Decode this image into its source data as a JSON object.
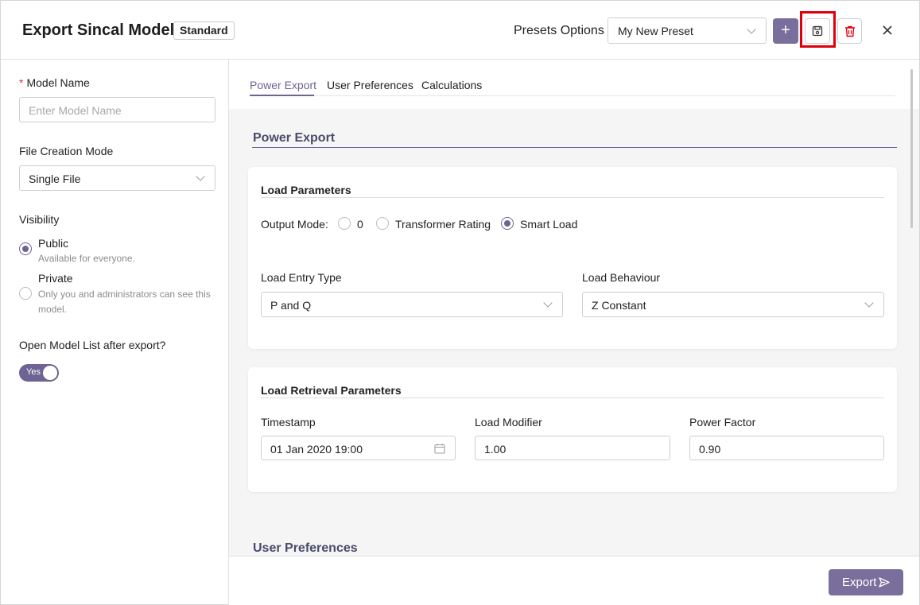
{
  "header": {
    "title": "Export Sincal Model",
    "badge": "Standard",
    "presets_label": "Presets Options",
    "preset_value": "My New Preset",
    "add_label": "+"
  },
  "left": {
    "model_name_label": "Model Name",
    "model_name_required": "*",
    "model_name_placeholder": "Enter Model Name",
    "file_mode_label": "File Creation Mode",
    "file_mode_value": "Single File",
    "visibility_label": "Visibility",
    "visibility_options": [
      {
        "label": "Public",
        "desc": "Available for everyone.",
        "selected": true
      },
      {
        "label": "Private",
        "desc_line1": "Only you and administrators can see this",
        "desc_line2": "model.",
        "selected": false
      }
    ],
    "open_list_label": "Open Model List after export?",
    "toggle_label": "Yes"
  },
  "tabs": [
    "Power Export",
    "User Preferences",
    "Calculations"
  ],
  "power_export": {
    "section_title": "Power Export",
    "load_params": {
      "title": "Load Parameters",
      "output_mode_label": "Output Mode:",
      "output_mode_options": [
        {
          "label": "0",
          "selected": false
        },
        {
          "label": "Transformer Rating",
          "selected": false
        },
        {
          "label": "Smart Load",
          "selected": true
        }
      ],
      "entry_type_label": "Load Entry Type",
      "entry_type_value": "P and Q",
      "behaviour_label": "Load Behaviour",
      "behaviour_value": "Z Constant"
    },
    "retrieval": {
      "title": "Load Retrieval Parameters",
      "timestamp_label": "Timestamp",
      "timestamp_value": "01 Jan 2020 19:00",
      "modifier_label": "Load Modifier",
      "modifier_value": "1.00",
      "power_factor_label": "Power Factor",
      "power_factor_value": "0.90"
    }
  },
  "user_preferences_title": "User Preferences",
  "footer": {
    "export_label": "Export"
  },
  "colors": {
    "accent": "#6f6393",
    "button": "#7a6e9c",
    "delete": "#e0000b",
    "highlight": "#e0000b"
  }
}
